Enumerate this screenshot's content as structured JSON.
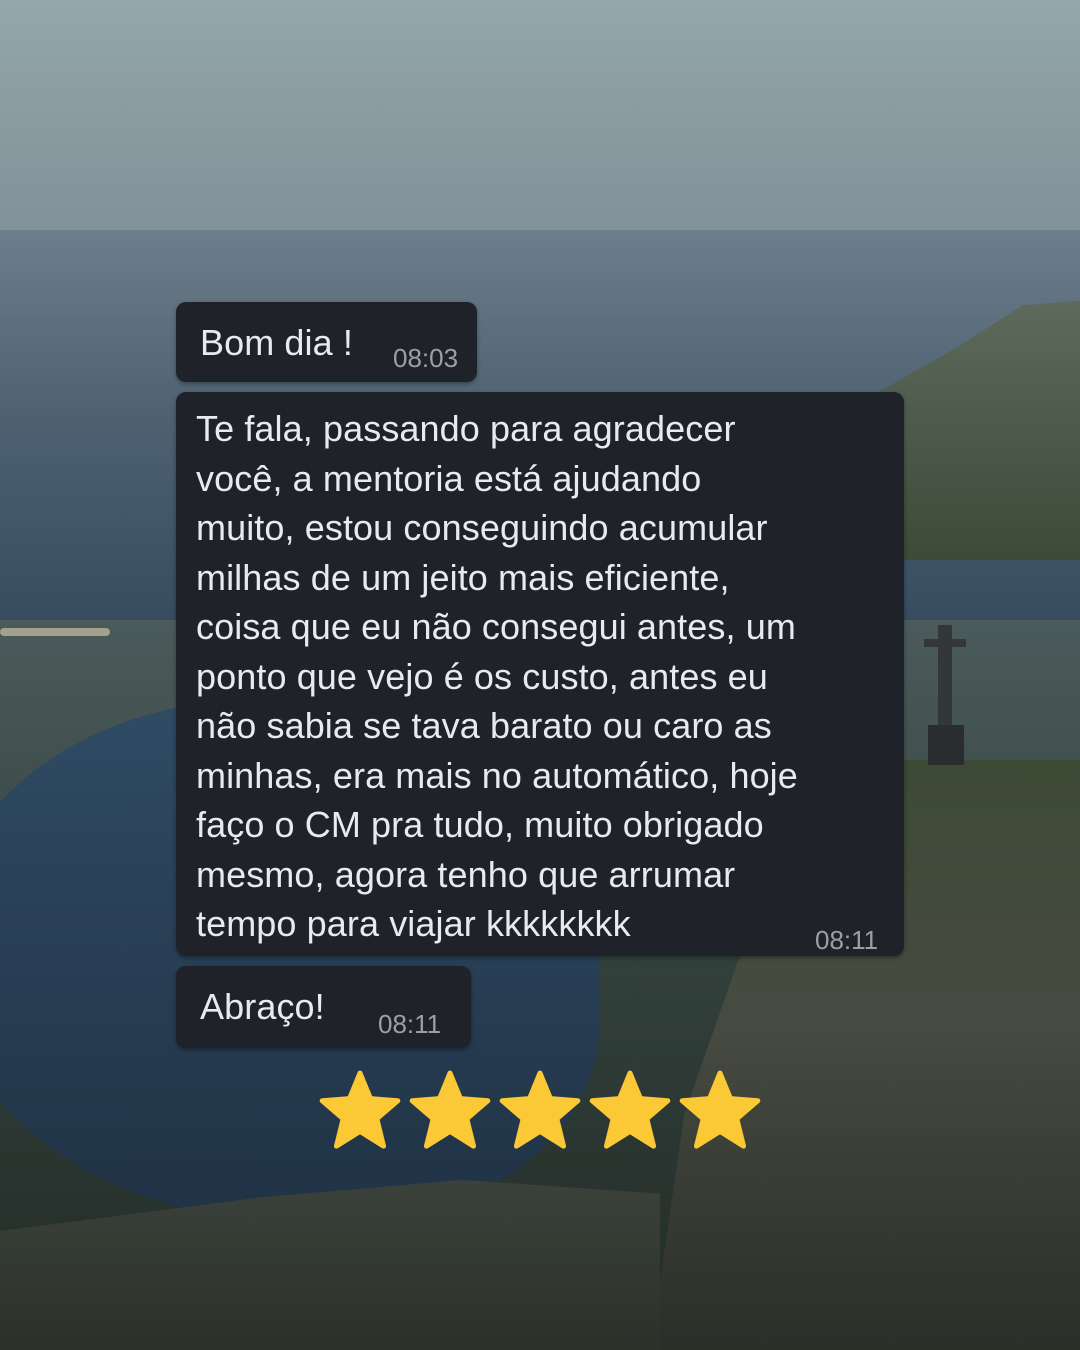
{
  "messages": [
    {
      "text": "Bom dia !",
      "time": "08:03"
    },
    {
      "text": "Te fala, passando para agradecer\nvocê, a mentoria está ajudando\nmuito, estou conseguindo acumular\nmilhas de um jeito mais eficiente,\ncoisa que eu não consegui antes, um\nponto que vejo é os custo, antes eu\nnão sabia se tava barato ou caro as\nminhas, era mais no automático, hoje\nfaço o CM pra tudo, muito obrigado\nmesmo, agora tenho que arrumar\ntempo para viajar kkkkkkkk",
      "time": "08:11"
    },
    {
      "text": "Abraço!",
      "time": "08:11"
    }
  ],
  "rating": {
    "stars": 5,
    "max": 5,
    "star_color": "#fbc935"
  },
  "colors": {
    "bubble": "#1f2329",
    "text": "#e8eaed",
    "time": "#9aa0a6"
  }
}
